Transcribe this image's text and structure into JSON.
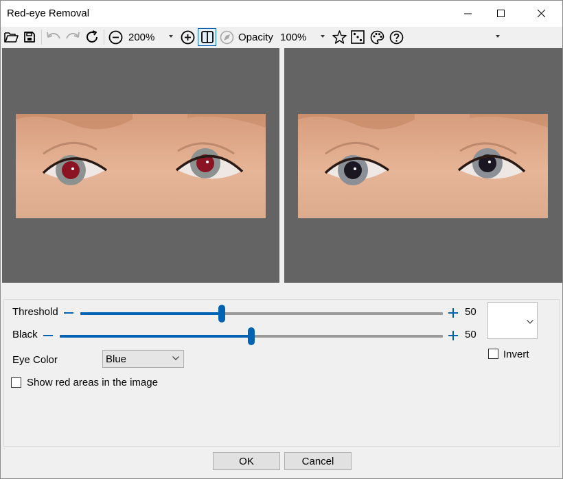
{
  "window": {
    "title": "Red-eye Removal"
  },
  "toolbar": {
    "zoom_value": "200%",
    "opacity_label": "Opacity",
    "opacity_value": "100%"
  },
  "controls": {
    "threshold_label": "Threshold",
    "threshold_value": "50",
    "threshold_level": 0.39,
    "black_label": "Black",
    "black_value": "50",
    "black_level": 0.5,
    "eye_color_label": "Eye Color",
    "eye_color_value": "Blue",
    "invert_label": "Invert",
    "invert_checked": false,
    "show_red_label": "Show red areas in the image",
    "show_red_checked": false
  },
  "buttons": {
    "ok": "OK",
    "cancel": "Cancel"
  },
  "colors": {
    "accent": "#0063b1",
    "preview_bg": "#646464",
    "red_eye": "#8a1423",
    "fixed_eye": "#1a1622"
  }
}
